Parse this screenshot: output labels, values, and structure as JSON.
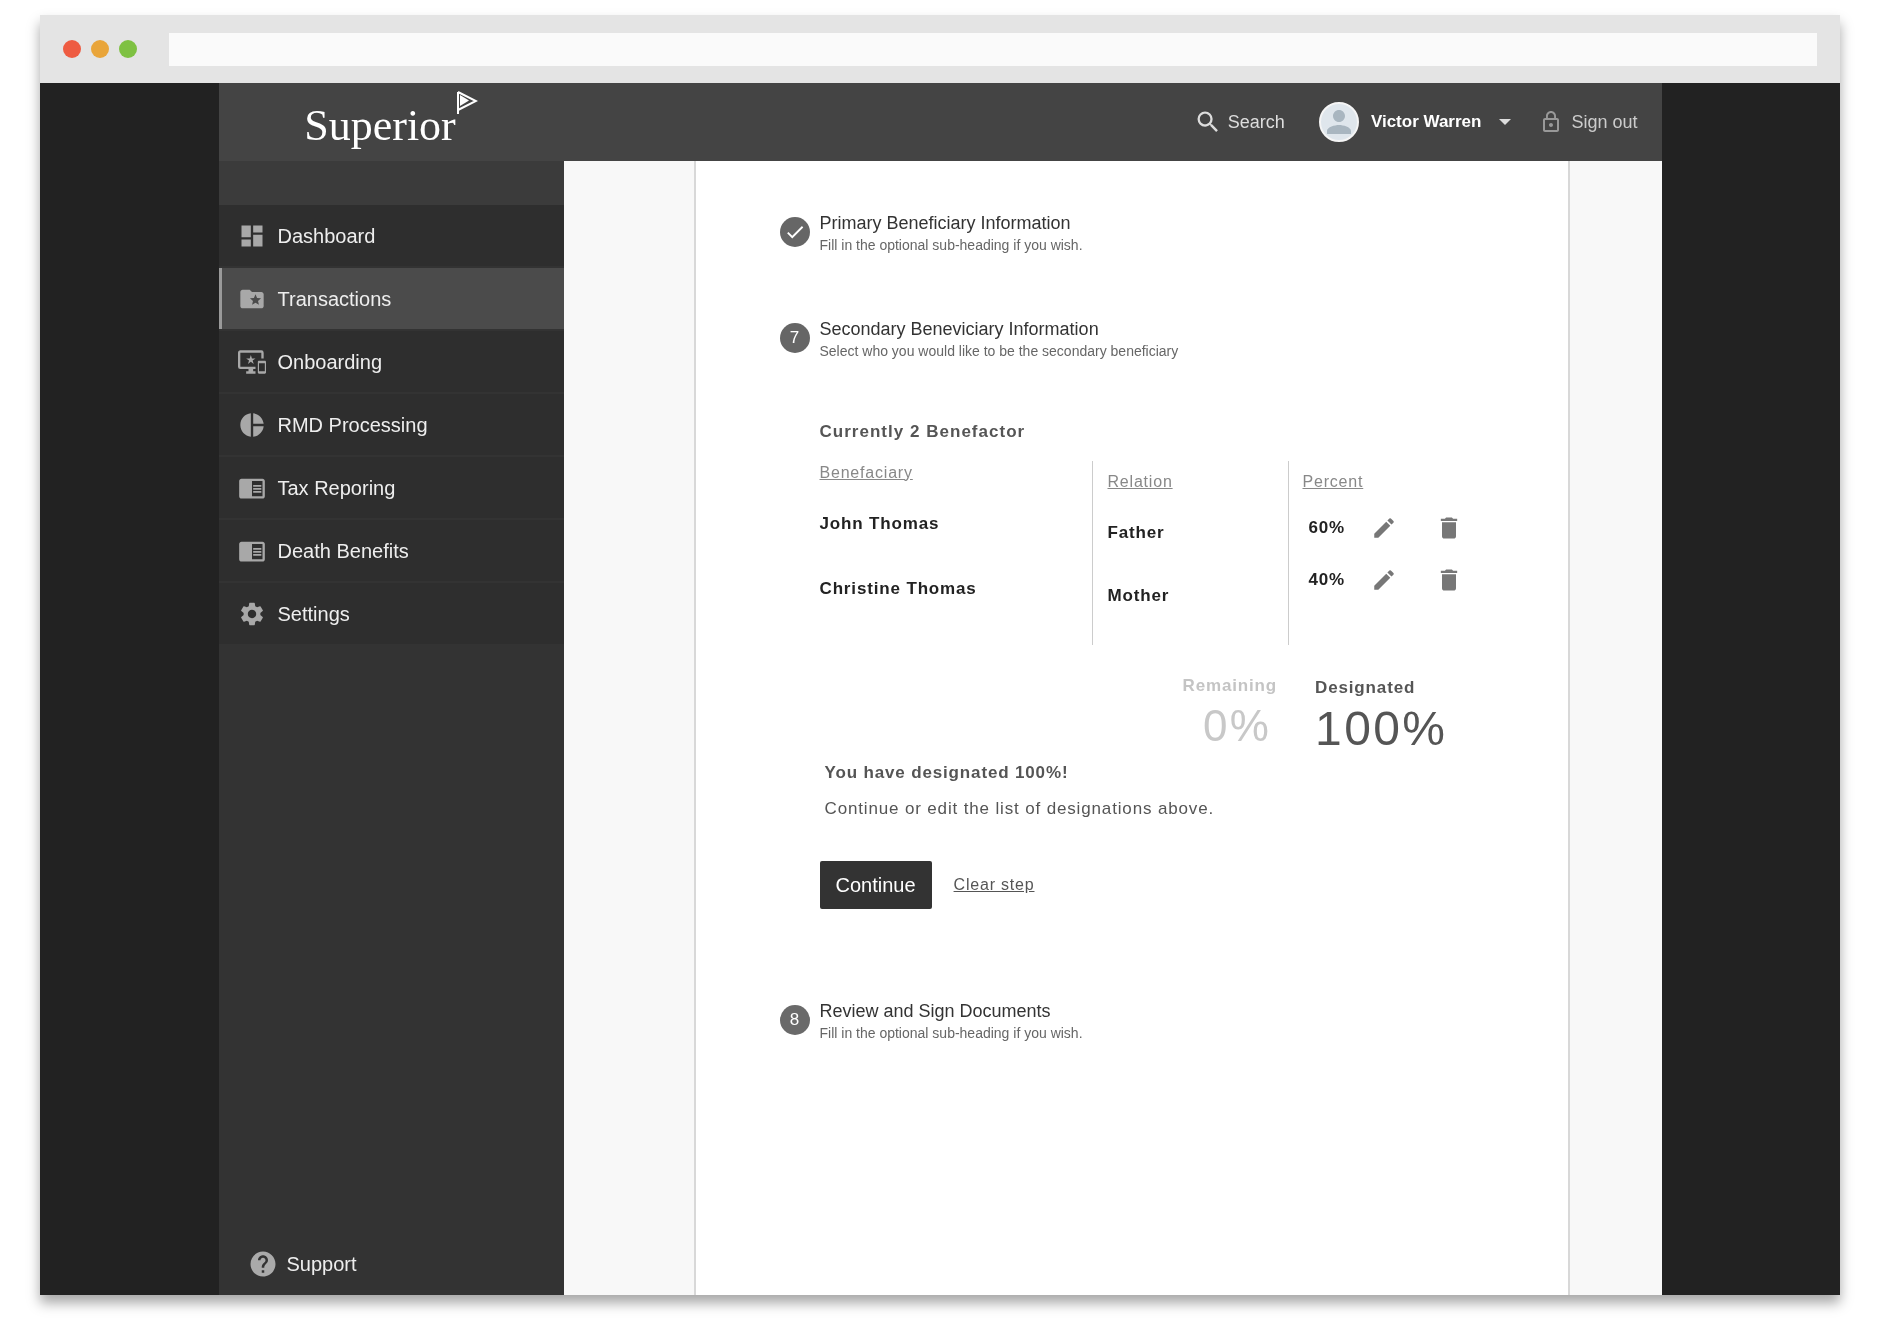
{
  "logo": "Superior",
  "header": {
    "search": "Search",
    "user": "Victor Warren",
    "sign_out": "Sign out"
  },
  "sidebar": {
    "items": [
      {
        "label": "Dashboard",
        "selected": false
      },
      {
        "label": "Transactions",
        "selected": true
      },
      {
        "label": "Onboarding",
        "selected": false
      },
      {
        "label": "RMD Processing",
        "selected": false
      },
      {
        "label": "Tax Reporing",
        "selected": false
      },
      {
        "label": "Death Benefits",
        "selected": false
      },
      {
        "label": "Settings",
        "selected": false
      }
    ],
    "support": "Support"
  },
  "steps": [
    {
      "kind": "done",
      "title": "Primary Beneficiary Information",
      "subtitle": "Fill in the optional sub-heading if you wish."
    },
    {
      "kind": "current",
      "number": "7",
      "title": "Secondary Beneviciary Information",
      "subtitle": "Select who you would like to be the secondary beneficiary"
    },
    {
      "kind": "pending",
      "number": "8",
      "title": "Review and Sign Documents",
      "subtitle": "Fill in the optional sub-heading if you wish."
    }
  ],
  "benefactors": {
    "heading": "Currently 2 Benefactor",
    "columns": [
      "Benefaciary",
      "Relation",
      "Percent"
    ],
    "rows": [
      {
        "name": "John Thomas",
        "relation": "Father",
        "percent": "60%"
      },
      {
        "name": "Christine Thomas",
        "relation": "Mother",
        "percent": "40%"
      }
    ]
  },
  "summary": {
    "remaining_label": "Remaining",
    "remaining_value": "0%",
    "designated_label": "Designated",
    "designated_value": "100%",
    "message": "You have designated 100%!",
    "note": "Continue or edit the list of designations above."
  },
  "actions": {
    "continue": "Continue",
    "clear": "Clear step"
  }
}
